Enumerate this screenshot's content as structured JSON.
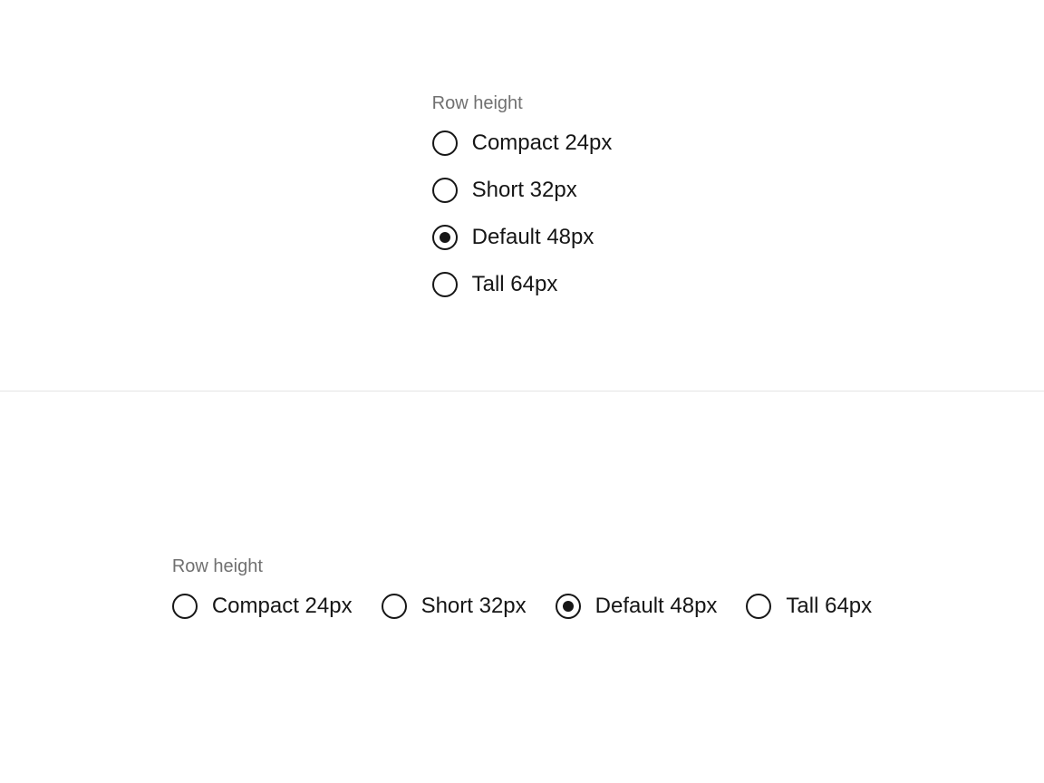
{
  "group1": {
    "label": "Row height",
    "options": [
      {
        "label": "Compact 24px",
        "selected": false
      },
      {
        "label": "Short 32px",
        "selected": false
      },
      {
        "label": "Default 48px",
        "selected": true
      },
      {
        "label": "Tall 64px",
        "selected": false
      }
    ]
  },
  "group2": {
    "label": "Row height",
    "options": [
      {
        "label": "Compact 24px",
        "selected": false
      },
      {
        "label": "Short 32px",
        "selected": false
      },
      {
        "label": "Default 48px",
        "selected": true
      },
      {
        "label": "Tall 64px",
        "selected": false
      }
    ]
  }
}
